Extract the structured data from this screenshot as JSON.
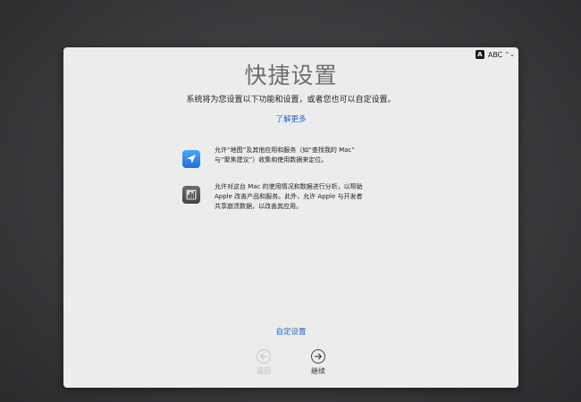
{
  "input_menu": {
    "icon": "input-source-A-icon",
    "label": "ABC"
  },
  "title": "快捷设置",
  "subtitle": "系统将为您设置以下功能和设置，或者您也可以自定设置。",
  "learn_more": "了解更多",
  "features": [
    {
      "icon": "location-arrow-icon",
      "lines": [
        "允许“地图”及其他应用和服务（如“查找我的 Mac”",
        "与“聚焦建议”）收集和使用数据来定位。"
      ]
    },
    {
      "icon": "analytics-chart-icon",
      "lines": [
        "允许对这台 Mac 的使用情况和数据进行分析，以帮助",
        "Apple 改善产品和服务。此外，允许 Apple 与开发者",
        "共享崩溃数据，以改善其应用。"
      ]
    }
  ],
  "customize": "自定设置",
  "buttons": {
    "back": "返回",
    "continue": "继续"
  },
  "colors": {
    "accent_link": "#1f66d1",
    "window_bg": "#ececec",
    "desktop_bg": "#3a3a3d"
  }
}
